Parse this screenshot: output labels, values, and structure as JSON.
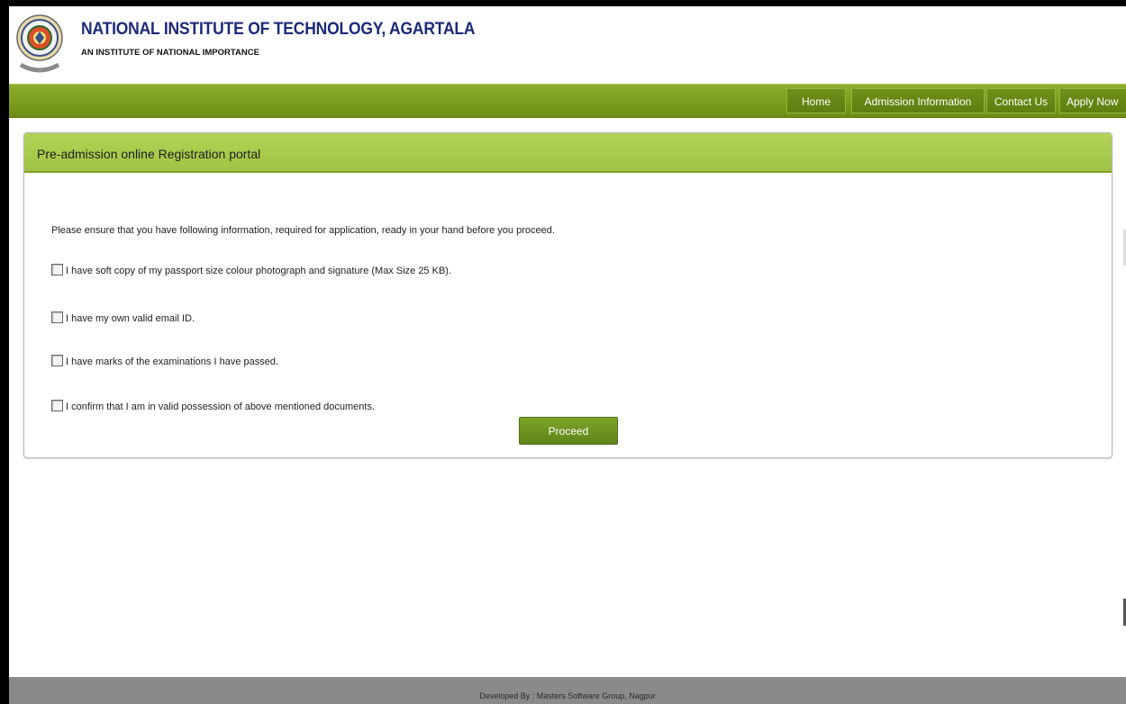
{
  "header": {
    "institute_name": "NATIONAL INSTITUTE OF TECHNOLOGY, AGARTALA",
    "tagline": "AN INSTITUTE OF NATIONAL IMPORTANCE",
    "logo_icon": "institute-seal-icon"
  },
  "nav": {
    "items": [
      {
        "label": "Home"
      },
      {
        "label": "Admission Information"
      },
      {
        "label": "Contact Us"
      },
      {
        "label": "Apply Now"
      }
    ]
  },
  "panel": {
    "title": "Pre-admission online Registration portal",
    "intro": "Please ensure that you have following information, required for application, ready in your hand before you proceed.",
    "checklist": [
      {
        "label": "I have soft copy of my passport size colour photograph and signature (Max Size 25 KB).",
        "checked": false
      },
      {
        "label": "I have my own valid email ID.",
        "checked": false
      },
      {
        "label": "I have marks of the examinations I have passed.",
        "checked": false
      },
      {
        "label": "I confirm that I am in valid possession of above mentioned documents.",
        "checked": false
      }
    ],
    "proceed_label": "Proceed"
  },
  "footer": {
    "text": "Developed By : Masters Software Group, Nagpur"
  },
  "colors": {
    "nav_green": "#7c9c1e",
    "panel_header_green": "#a8cb4c",
    "button_green": "#6d931f",
    "title_blue": "#1b2a7a",
    "footer_gray": "#8a8a8a"
  }
}
